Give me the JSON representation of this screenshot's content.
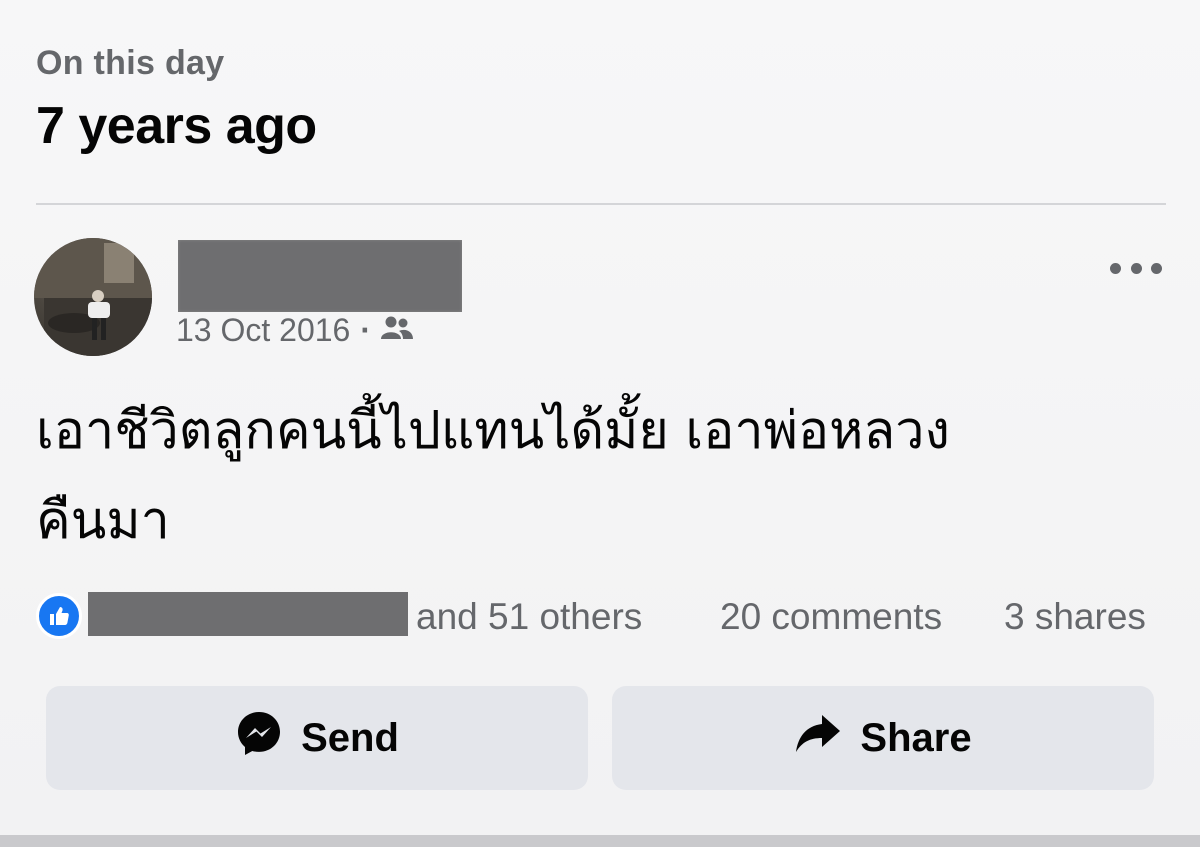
{
  "memory": {
    "subtitle": "On this day",
    "title": "7 years ago"
  },
  "post": {
    "date": "13 Oct 2016",
    "separator": "·",
    "audience_icon": "friends-icon",
    "text": "เอาชีวิตลูกคนนี้ไปแทนได้มั้ย เอาพ่อหลวง\nคืนมา"
  },
  "stats": {
    "reaction_icon": "like-icon",
    "others": "and 51 others",
    "comments": "20 comments",
    "shares": "3 shares"
  },
  "actions": {
    "send_label": "Send",
    "send_icon": "messenger-icon",
    "share_label": "Share",
    "share_icon": "share-arrow-icon"
  },
  "colors": {
    "like_blue": "#1877f2",
    "secondary_text": "#65676b",
    "button_bg": "#e4e6eb"
  }
}
